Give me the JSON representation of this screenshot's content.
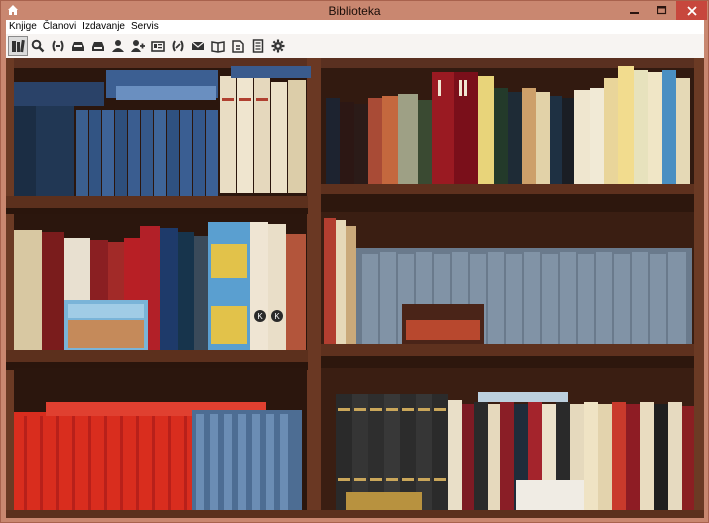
{
  "window": {
    "title": "Biblioteka"
  },
  "menu": {
    "items": [
      "Knjige",
      "Članovi",
      "Izdavanje",
      "Servis"
    ]
  },
  "toolbar": {
    "tools": [
      "books-icon",
      "search-icon",
      "link-icon",
      "tray-icon",
      "tray-out-icon",
      "person-icon",
      "add-person-icon",
      "id-card-icon",
      "link-2-icon",
      "envelope-icon",
      "open-book-icon",
      "return-book-icon",
      "document-icon",
      "gear-icon"
    ]
  },
  "colors": {
    "frame": "#c98770",
    "close": "#c7473d",
    "toolbar": "#f7f4f2",
    "shelf": "#4a2a1c"
  },
  "background": {
    "subject": "wooden bookshelf full of books",
    "shelf_book": {
      "badge": "K"
    }
  }
}
